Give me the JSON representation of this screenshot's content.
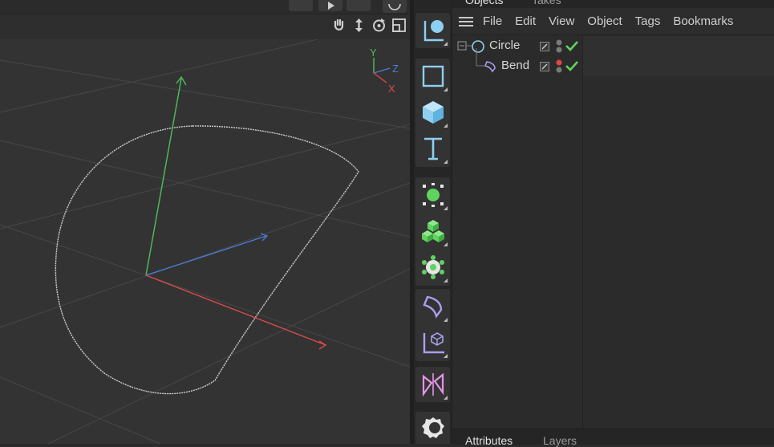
{
  "viewport": {
    "axis_labels": {
      "y": "Y",
      "z": "Z",
      "x": "X"
    },
    "nav_icons": [
      "hand-pan-icon",
      "move-arrows-icon",
      "rotate-icon",
      "maximize-icon"
    ]
  },
  "toolbar": {
    "tools": [
      "axis-create-icon",
      "square-spline-icon",
      "cube-icon",
      "text-tool-icon",
      "light-icon",
      "cloner-icon",
      "mograph-effector-icon",
      "bend-deformer-icon",
      "coordinate-system-icon",
      "symmetry-icon",
      "environment-icon"
    ]
  },
  "object_manager": {
    "tabs": {
      "objects": "Objects",
      "takes": "Takes"
    },
    "menu": [
      "File",
      "Edit",
      "View",
      "Object",
      "Tags",
      "Bookmarks"
    ],
    "objects": [
      {
        "name": "Circle",
        "icon": "circle-spline-icon",
        "visible": true,
        "enabled": true
      },
      {
        "name": "Bend",
        "icon": "bend-deformer-icon",
        "visible": true,
        "enabled": true
      }
    ]
  },
  "bottom_tabs": {
    "attributes": "Attributes",
    "layers": "Layers"
  },
  "colors": {
    "accent_blue": "#8ecff2",
    "accent_green": "#5fd35f",
    "axis_x": "#d74b4b",
    "axis_y": "#4fbf5a",
    "axis_z": "#4a7bd6"
  }
}
